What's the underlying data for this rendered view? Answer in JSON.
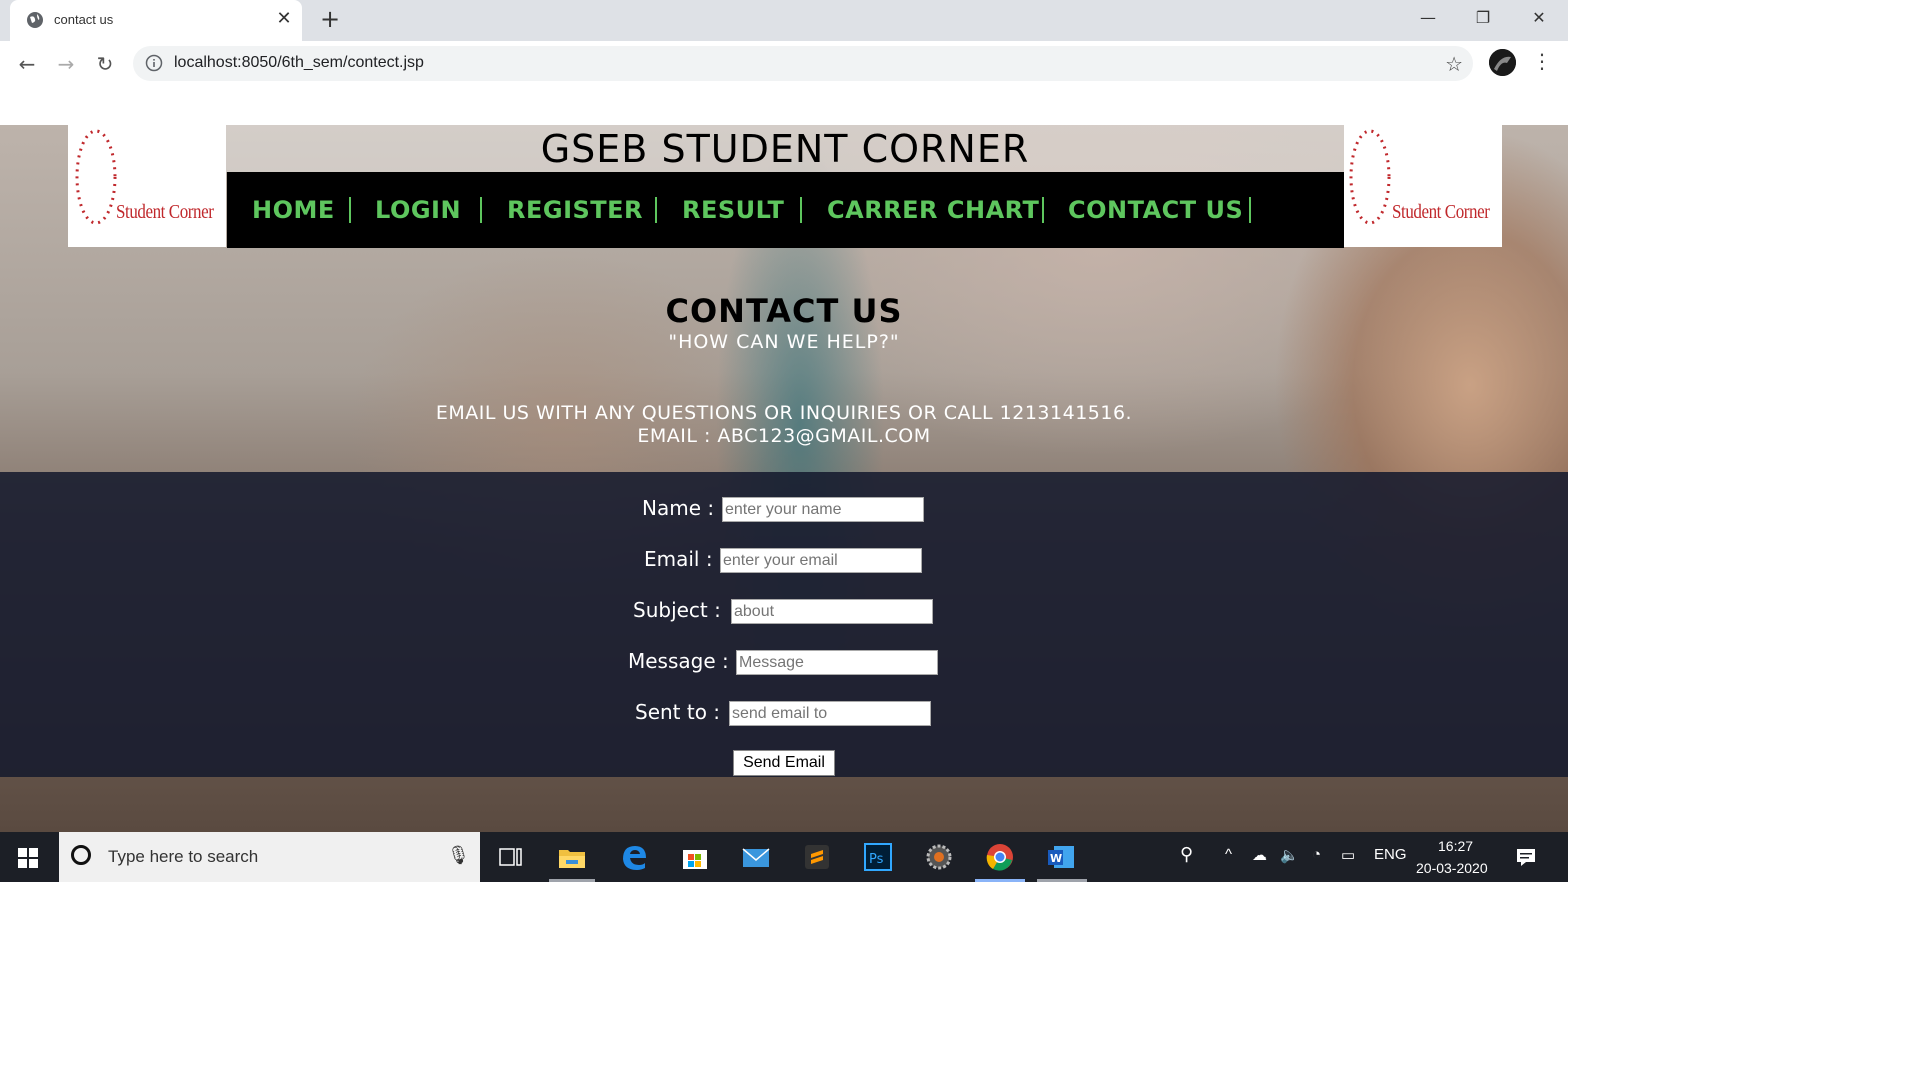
{
  "browser": {
    "tab_title": "contact us",
    "url": "localhost:8050/6th_sem/contect.jsp"
  },
  "site": {
    "title": "GSEB STUDENT CORNER",
    "logo_text": "Student Corner",
    "nav": [
      "HOME",
      "LOGIN",
      "REGISTER",
      "RESULT",
      "CARRER CHART",
      "CONTACT US"
    ]
  },
  "contact": {
    "heading": "CONTACT US",
    "subheading": "\"HOW CAN WE HELP?\"",
    "info_line1": "EMAIL US WITH ANY QUESTIONS OR INQUIRIES OR CALL 1213141516.",
    "info_line2": "EMAIL : ABC123@GMAIL.COM"
  },
  "form": {
    "fields": [
      {
        "label": "Name :",
        "placeholder": "enter your name"
      },
      {
        "label": "Email :",
        "placeholder": "enter your email"
      },
      {
        "label": "Subject :",
        "placeholder": "about"
      },
      {
        "label": "Message :",
        "placeholder": "Message"
      },
      {
        "label": "Sent to :",
        "placeholder": "send email to"
      }
    ],
    "submit_label": "Send Email"
  },
  "taskbar": {
    "search_placeholder": "Type here to search",
    "language": "ENG",
    "time": "16:27",
    "date": "20-03-2020"
  },
  "colors": {
    "nav_green": "#5ec65e",
    "logo_red": "#c0282c",
    "form_band": "#161a2d"
  }
}
